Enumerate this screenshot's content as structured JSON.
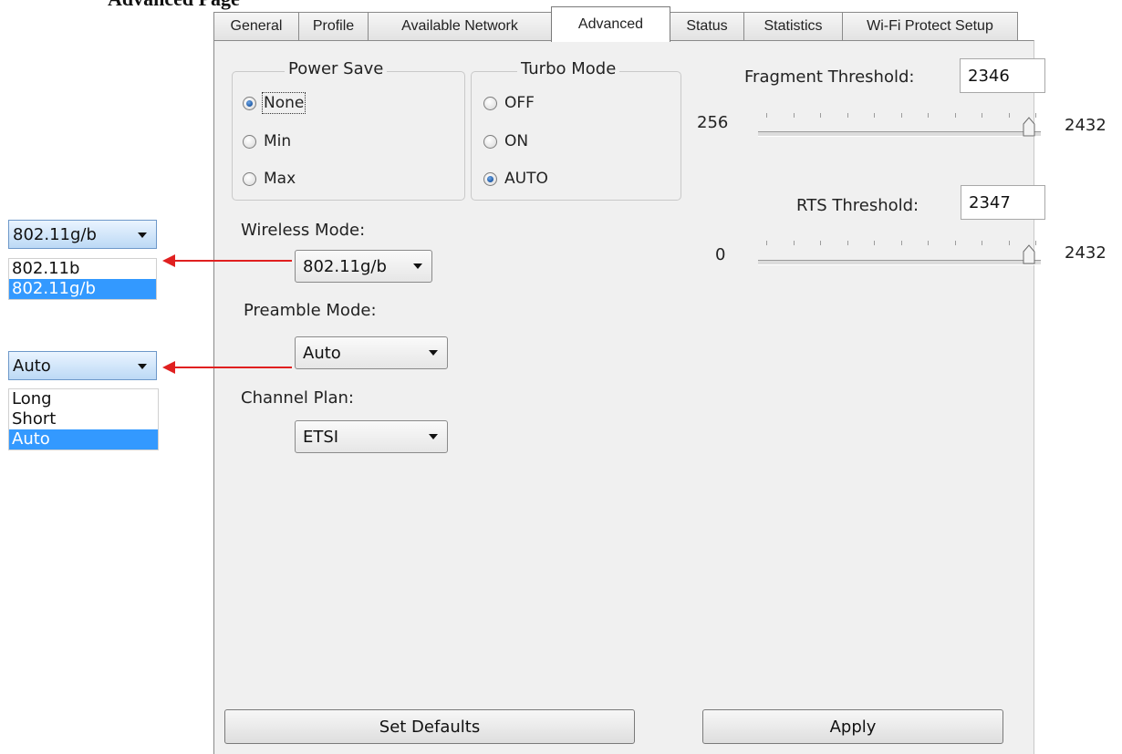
{
  "heading": "Advanced Page",
  "tabs": [
    {
      "label": "General",
      "active": false
    },
    {
      "label": "Profile",
      "active": false
    },
    {
      "label": "Available Network",
      "active": false
    },
    {
      "label": "Advanced",
      "active": true
    },
    {
      "label": "Status",
      "active": false
    },
    {
      "label": "Statistics",
      "active": false
    },
    {
      "label": "Wi-Fi Protect Setup",
      "active": false
    }
  ],
  "power_save": {
    "title": "Power Save",
    "options": [
      "None",
      "Min",
      "Max"
    ],
    "selected": "None"
  },
  "turbo_mode": {
    "title": "Turbo Mode",
    "options": [
      "OFF",
      "ON",
      "AUTO"
    ],
    "selected": "AUTO"
  },
  "wireless_mode": {
    "label": "Wireless Mode:",
    "value": "802.11g/b"
  },
  "preamble_mode": {
    "label": "Preamble Mode:",
    "value": "Auto"
  },
  "channel_plan": {
    "label": "Channel Plan:",
    "value": "ETSI"
  },
  "fragment_threshold": {
    "label": "Fragment Threshold:",
    "value": "2346",
    "min": "256",
    "max": "2432"
  },
  "rts_threshold": {
    "label": "RTS Threshold:",
    "value": "2347",
    "min": "0",
    "max": "2432"
  },
  "buttons": {
    "set_defaults": "Set Defaults",
    "apply": "Apply"
  },
  "callouts": {
    "wireless_dropdown": {
      "selected": "802.11g/b",
      "options": [
        "802.11b",
        "802.11g/b"
      ]
    },
    "preamble_dropdown": {
      "selected": "Auto",
      "options": [
        "Long",
        "Short",
        "Auto"
      ]
    }
  },
  "colors": {
    "arrow": "#e02020",
    "highlight": "#3399ff"
  }
}
